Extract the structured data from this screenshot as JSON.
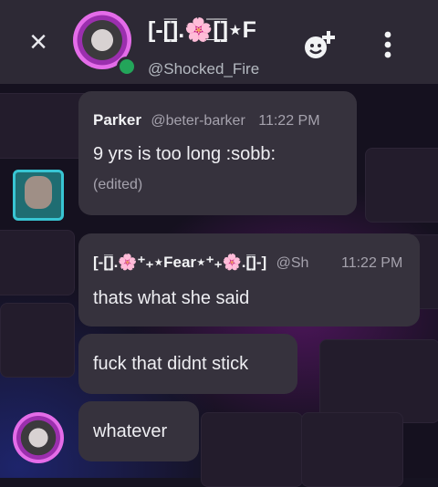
{
  "header": {
    "title": "[-[̲̅].🌸̲̅[̲̅]⋆F",
    "handle": "@Shocked_Fire",
    "close_glyph": "×"
  },
  "messages": [
    {
      "author": "Parker",
      "handle": "@beter-barker",
      "time": "11:22 PM",
      "text": "9 yrs is too long :sobb:",
      "edited": "(edited)"
    },
    {
      "author": "[-[̲̅].🌸⁺₊⋆Fear⋆⁺₊🌸.[̲̅]-]",
      "handle": "@Sh",
      "time": "11:22 PM",
      "text": "thats what she said"
    },
    {
      "text": "fuck that didnt stick"
    },
    {
      "text": "whatever"
    }
  ]
}
